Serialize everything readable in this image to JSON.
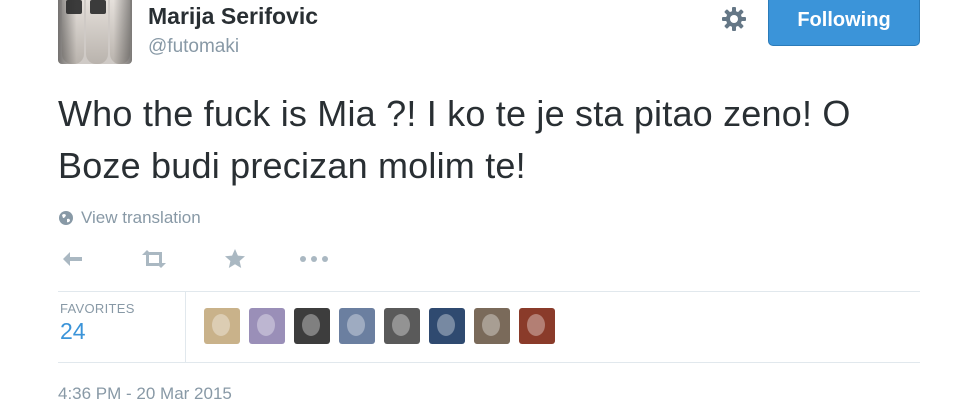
{
  "user": {
    "display_name": "Marija Serifovic",
    "handle": "@futomaki",
    "avatar_icon": "tattooed-fingers-photo"
  },
  "header": {
    "settings_icon": "gear-icon",
    "follow_label": "Following"
  },
  "tweet": {
    "text": "Who the fuck is Mia ?! I ko te je sta pitao zeno! O Boze budi precizan molim te!",
    "translate_label": "View translation",
    "translate_icon": "globe-icon"
  },
  "actions": [
    {
      "name": "reply",
      "icon": "reply-icon"
    },
    {
      "name": "retweet",
      "icon": "retweet-icon"
    },
    {
      "name": "favorite",
      "icon": "star-icon"
    },
    {
      "name": "more",
      "icon": "more-icon"
    }
  ],
  "stats": {
    "favorites_label": "FAVORITES",
    "favorites_count": "24",
    "favoriter_avatars": [
      {
        "bg": "#c9b28a"
      },
      {
        "bg": "#9a8fb8"
      },
      {
        "bg": "#3d3d3d"
      },
      {
        "bg": "#6b7fa0"
      },
      {
        "bg": "#5a5a5a"
      },
      {
        "bg": "#2f4a70"
      },
      {
        "bg": "#7a6a5a"
      },
      {
        "bg": "#8a3b2a"
      }
    ]
  },
  "timestamp": "4:36 PM - 20 Mar 2015",
  "colors": {
    "accent": "#3b94d9",
    "muted": "#8899a6",
    "text": "#292f33",
    "divider": "#e1e8ed"
  }
}
